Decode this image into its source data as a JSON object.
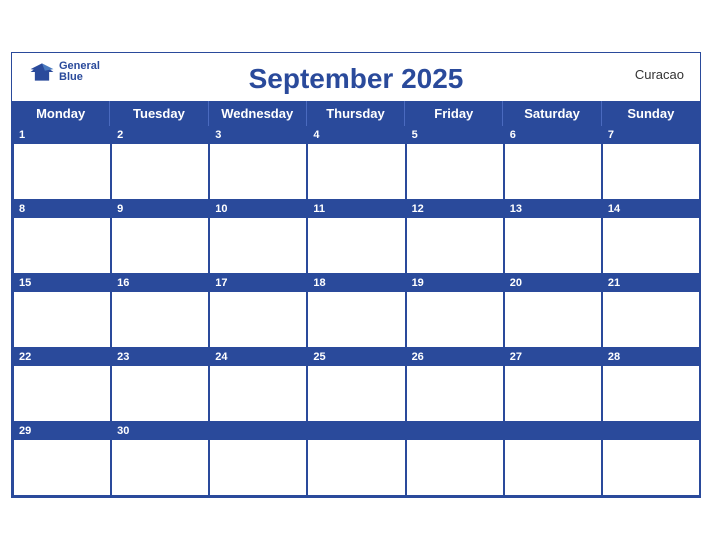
{
  "calendar": {
    "title": "September 2025",
    "region": "Curacao",
    "logo": {
      "line1": "General",
      "line2": "Blue"
    },
    "days": [
      "Monday",
      "Tuesday",
      "Wednesday",
      "Thursday",
      "Friday",
      "Saturday",
      "Sunday"
    ],
    "weeks": [
      [
        1,
        2,
        3,
        4,
        5,
        6,
        7
      ],
      [
        8,
        9,
        10,
        11,
        12,
        13,
        14
      ],
      [
        15,
        16,
        17,
        18,
        19,
        20,
        21
      ],
      [
        22,
        23,
        24,
        25,
        26,
        27,
        28
      ],
      [
        29,
        30,
        null,
        null,
        null,
        null,
        null
      ]
    ]
  }
}
